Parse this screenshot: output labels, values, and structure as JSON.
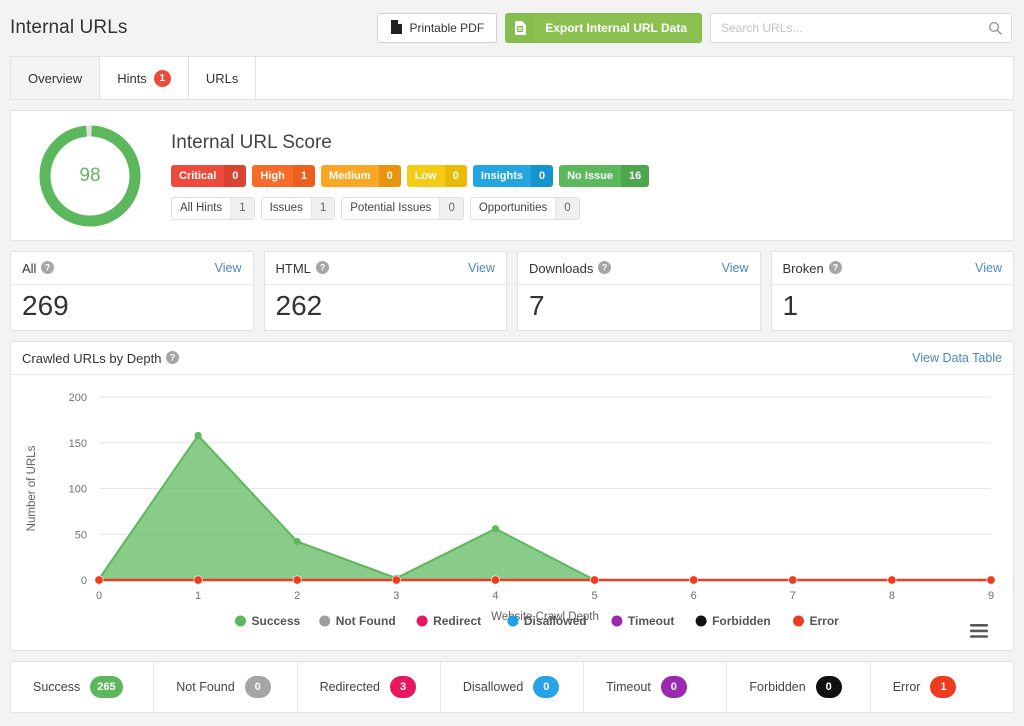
{
  "header": {
    "title": "Internal URLs",
    "printable_pdf_label": "Printable PDF",
    "printable_pdf_icon": "file-pdf-icon",
    "export_label": "Export Internal URL Data",
    "export_icon": "file-spreadsheet-icon",
    "search_placeholder": "Search URLs...",
    "search_value": "",
    "search_icon": "search-icon"
  },
  "tabs": [
    {
      "label": "Overview",
      "active": true,
      "badge": null
    },
    {
      "label": "Hints",
      "active": false,
      "badge": "1"
    },
    {
      "label": "URLs",
      "active": false,
      "badge": null
    }
  ],
  "score": {
    "value": "98",
    "percent": 98,
    "title": "Internal URL Score",
    "severities": [
      {
        "label": "Critical",
        "count": "0",
        "color": "#ef4b3c",
        "dark": "#d9432f"
      },
      {
        "label": "High",
        "count": "1",
        "color": "#f86b28",
        "dark": "#ed5f1c"
      },
      {
        "label": "Medium",
        "count": "0",
        "color": "#f9a825",
        "dark": "#e8940d"
      },
      {
        "label": "Low",
        "count": "0",
        "color": "#f6cb16",
        "dark": "#e8bc06"
      },
      {
        "label": "Insights",
        "count": "0",
        "color": "#23a6e0",
        "dark": "#1595cf"
      },
      {
        "label": "No Issue",
        "count": "16",
        "color": "#5cb85c",
        "dark": "#4ca64c"
      }
    ],
    "chips": [
      {
        "label": "All Hints",
        "count": "1"
      },
      {
        "label": "Issues",
        "count": "1"
      },
      {
        "label": "Potential Issues",
        "count": "0"
      },
      {
        "label": "Opportunities",
        "count": "0"
      }
    ]
  },
  "stats": [
    {
      "label": "All",
      "value": "269",
      "view_label": "View",
      "help_icon": "question-circle-icon"
    },
    {
      "label": "HTML",
      "value": "262",
      "view_label": "View",
      "help_icon": "question-circle-icon"
    },
    {
      "label": "Downloads",
      "value": "7",
      "view_label": "View",
      "help_icon": "question-circle-icon"
    },
    {
      "label": "Broken",
      "value": "1",
      "view_label": "View",
      "help_icon": "question-circle-icon"
    }
  ],
  "chart_panel": {
    "title": "Crawled URLs by Depth",
    "help_icon": "question-circle-icon",
    "view_data_table_label": "View Data Table",
    "context_menu_icon": "hamburger-menu-icon"
  },
  "chart_data": {
    "type": "area",
    "title": "Crawled URLs by Depth",
    "xlabel": "Website Crawl Depth",
    "ylabel": "Number of URLs",
    "x": [
      0,
      1,
      2,
      3,
      4,
      5,
      6,
      7,
      8,
      9
    ],
    "xticks": [
      "0",
      "1",
      "2",
      "3",
      "4",
      "5",
      "6",
      "7",
      "8",
      "9"
    ],
    "yticks": [
      "0",
      "50",
      "100",
      "150",
      "200"
    ],
    "ylim": [
      0,
      200
    ],
    "grid": true,
    "legend_position": "bottom",
    "series": [
      {
        "name": "Success",
        "color": "#5cb85c",
        "values": [
          1,
          158,
          42,
          2,
          56,
          0,
          0,
          0,
          0,
          0
        ]
      },
      {
        "name": "Not Found",
        "color": "#9e9e9e",
        "values": [
          0,
          0,
          0,
          0,
          0,
          0,
          0,
          0,
          0,
          0
        ]
      },
      {
        "name": "Redirect",
        "color": "#e8175d",
        "values": [
          0,
          1,
          1,
          0,
          1,
          0,
          0,
          0,
          0,
          0
        ]
      },
      {
        "name": "Disallowed",
        "color": "#1e9fe8",
        "values": [
          0,
          0,
          0,
          0,
          0,
          0,
          0,
          0,
          0,
          0
        ]
      },
      {
        "name": "Timeout",
        "color": "#9c27b0",
        "values": [
          0,
          0,
          0,
          0,
          0,
          0,
          0,
          0,
          0,
          0
        ]
      },
      {
        "name": "Forbidden",
        "color": "#111111",
        "values": [
          0,
          0,
          0,
          0,
          0,
          0,
          0,
          0,
          0,
          0
        ]
      },
      {
        "name": "Error",
        "color": "#ef3b1f",
        "values": [
          0,
          1,
          1,
          0,
          1,
          0,
          0,
          0,
          0,
          0
        ]
      }
    ]
  },
  "status_bar": [
    {
      "label": "Success",
      "count": "265",
      "color": "#5cb85c"
    },
    {
      "label": "Not Found",
      "count": "0",
      "color": "#a5a5a5"
    },
    {
      "label": "Redirected",
      "count": "3",
      "color": "#e8175d"
    },
    {
      "label": "Disallowed",
      "count": "0",
      "color": "#29a3e8"
    },
    {
      "label": "Timeout",
      "count": "0",
      "color": "#9c27b0"
    },
    {
      "label": "Forbidden",
      "count": "0",
      "color": "#111111"
    },
    {
      "label": "Error",
      "count": "1",
      "color": "#ef3b1f"
    }
  ]
}
